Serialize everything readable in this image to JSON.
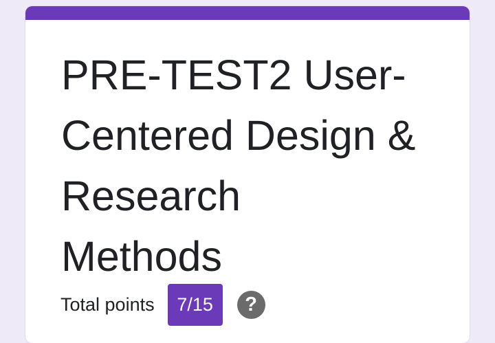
{
  "form": {
    "title": "PRE-TEST2 User-Centered Design & Research Methods",
    "title_lines": [
      "PRE-TEST2 User-",
      "Centered Design &",
      "Research",
      "Methods"
    ],
    "total_points_label": "Total points",
    "score": "7/15",
    "help_icon": "question-mark-icon"
  },
  "colors": {
    "accent": "#6a3ab8",
    "page_background": "#efeaf7",
    "card_background": "#ffffff",
    "text": "#202124",
    "help_icon": "#6b6b6b"
  }
}
